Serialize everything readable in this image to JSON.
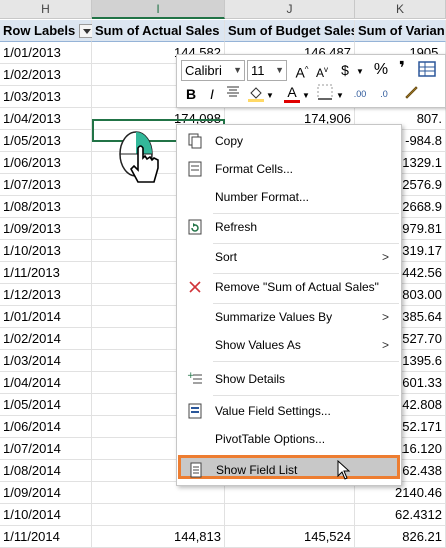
{
  "columns": [
    "H",
    "I",
    "J",
    "K"
  ],
  "headers": {
    "row_labels": "Row Labels",
    "actual": "Sum of Actual Sales",
    "budget": "Sum of Budget Sales",
    "variance": "Sum of Varian"
  },
  "rows": [
    {
      "date": "1/01/2013",
      "actual": "144,582",
      "budget": "146,487",
      "variance": "1905."
    },
    {
      "date": "1/02/2013",
      "actual": "",
      "budget": "",
      "variance": ""
    },
    {
      "date": "1/03/2013",
      "actual": "",
      "budget": "",
      "variance": ""
    },
    {
      "date": "1/04/2013",
      "actual": "174,098",
      "budget": "174,906",
      "variance": "807."
    },
    {
      "date": "1/05/2013",
      "actual": "",
      "budget": "",
      "variance": "-984.8"
    },
    {
      "date": "1/06/2013",
      "actual": "",
      "budget": "",
      "variance": "1329.1"
    },
    {
      "date": "1/07/2013",
      "actual": "",
      "budget": "",
      "variance": "2576.9"
    },
    {
      "date": "1/08/2013",
      "actual": "",
      "budget": "",
      "variance": "2668.9"
    },
    {
      "date": "1/09/2013",
      "actual": "",
      "budget": "",
      "variance": "979.81"
    },
    {
      "date": "1/10/2013",
      "actual": "",
      "budget": "",
      "variance": "-319.17"
    },
    {
      "date": "1/11/2013",
      "actual": "",
      "budget": "",
      "variance": "442.56"
    },
    {
      "date": "1/12/2013",
      "actual": "",
      "budget": "",
      "variance": "1803.00"
    },
    {
      "date": "1/01/2014",
      "actual": "",
      "budget": "",
      "variance": "3385.64"
    },
    {
      "date": "1/02/2014",
      "actual": "",
      "budget": "",
      "variance": "-527.70"
    },
    {
      "date": "1/03/2014",
      "actual": "",
      "budget": "",
      "variance": "-1395.6"
    },
    {
      "date": "1/04/2014",
      "actual": "",
      "budget": "",
      "variance": "2601.33"
    },
    {
      "date": "1/05/2014",
      "actual": "",
      "budget": "",
      "variance": "3742.808"
    },
    {
      "date": "1/06/2014",
      "actual": "",
      "budget": "",
      "variance": "152.171"
    },
    {
      "date": "1/07/2014",
      "actual": "",
      "budget": "",
      "variance": "116.120"
    },
    {
      "date": "1/08/2014",
      "actual": "",
      "budget": "",
      "variance": "262.438"
    },
    {
      "date": "1/09/2014",
      "actual": "",
      "budget": "",
      "variance": "2140.46"
    },
    {
      "date": "1/10/2014",
      "actual": "",
      "budget": "",
      "variance": "62.4312"
    },
    {
      "date": "1/11/2014",
      "actual": "144,813",
      "budget": "145,524",
      "variance": "826.21"
    }
  ],
  "mini_toolbar": {
    "font_name": "Calibri",
    "font_size": "11",
    "increase_font": "A",
    "decrease_font": "A",
    "currency": "$",
    "percent": "%",
    "comma": "❜",
    "bold": "B",
    "italic": "I",
    "font_color_letter": "A",
    "decimal_more": ".00",
    "decimal_less": ".0",
    "colors": {
      "fill": "#ffd966",
      "font": "#e00000"
    }
  },
  "context_menu": {
    "copy": "Copy",
    "format_cells": "Format Cells...",
    "number_format": "Number Format...",
    "refresh": "Refresh",
    "sort": "Sort",
    "remove": "Remove \"Sum of Actual Sales\"",
    "summarize": "Summarize Values By",
    "show_values_as": "Show Values As",
    "show_details": "Show Details",
    "value_field_settings": "Value Field Settings...",
    "pivottable_options": "PivotTable Options...",
    "show_field_list": "Show Field List",
    "highlight_color": "#ed7d31"
  }
}
